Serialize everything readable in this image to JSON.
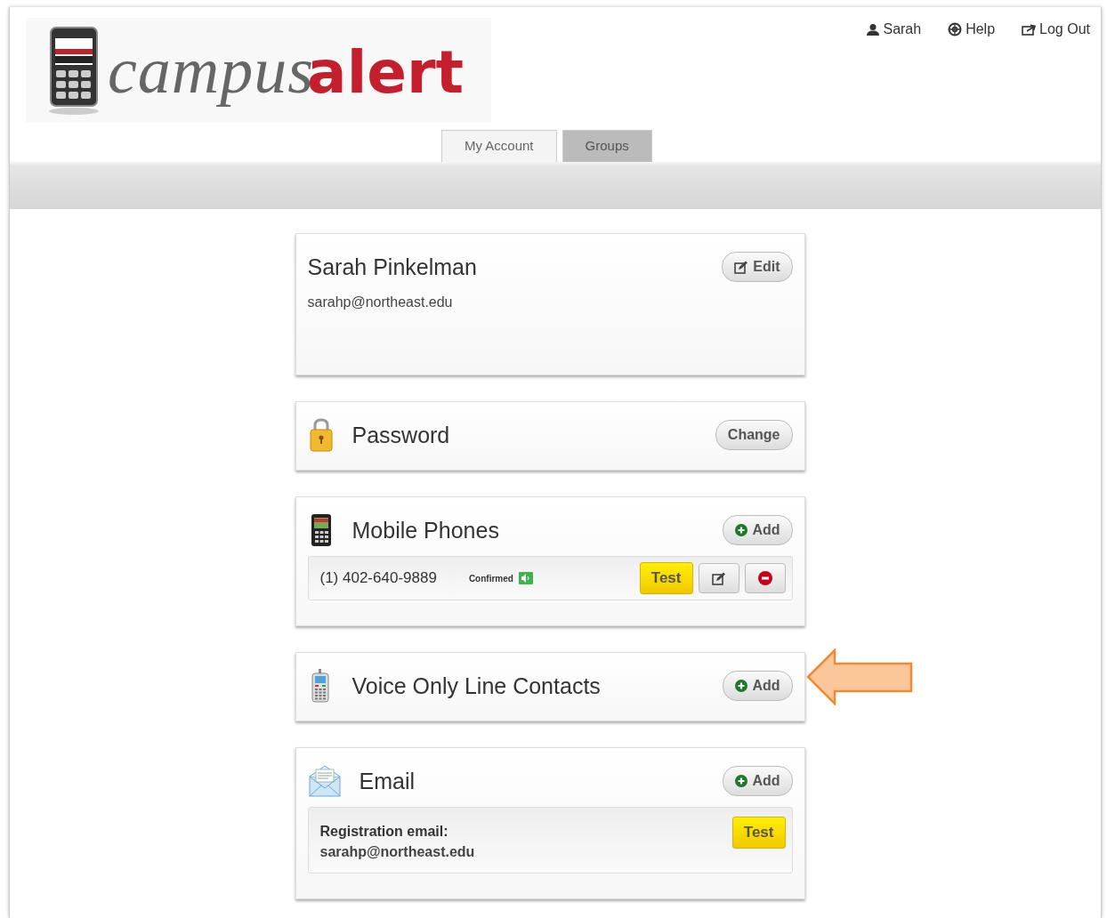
{
  "logo": {
    "campus": "campus",
    "alert": "alert"
  },
  "user_menu": [
    {
      "kind": "user",
      "label": "Sarah"
    },
    {
      "kind": "help",
      "label": "Help"
    },
    {
      "kind": "logout",
      "label": "Log Out"
    }
  ],
  "tabs": [
    {
      "label": "My Account",
      "selected": true
    },
    {
      "label": "Groups",
      "selected": false
    }
  ],
  "profile": {
    "name": "Sarah Pinkelman",
    "email": "sarahp@northeast.edu",
    "button": "Edit"
  },
  "sections": [
    {
      "kind": "password",
      "title": "Password",
      "button": "Change",
      "highlighted": false
    },
    {
      "kind": "mobile",
      "title": "Mobile Phones",
      "button": "Add",
      "highlighted": false,
      "entries": [
        {
          "number": "(1) 402-640-9889",
          "status": "Confirmed",
          "test": "Test"
        }
      ]
    },
    {
      "kind": "voice",
      "title": "Voice Only Line Contacts",
      "button": "Add",
      "highlighted": true
    },
    {
      "kind": "email",
      "title": "Email",
      "button": "Add",
      "highlighted": false,
      "entries": [
        {
          "label": "Registration email:",
          "email": "sarahp@northeast.edu",
          "test": "Test"
        }
      ]
    }
  ]
}
